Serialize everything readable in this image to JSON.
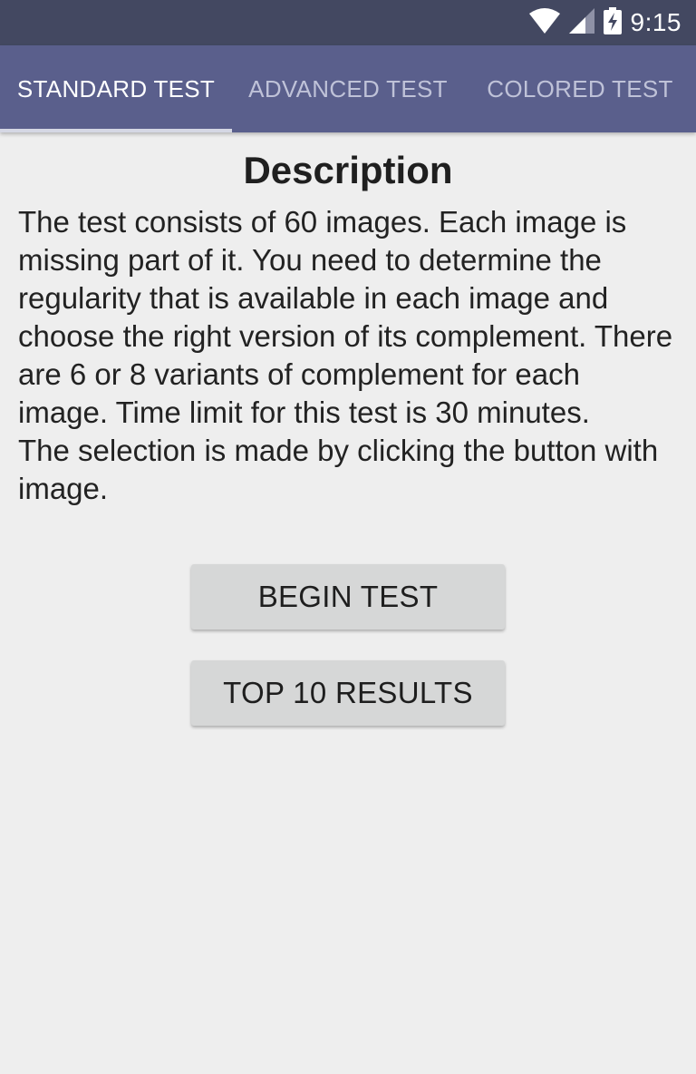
{
  "status_bar": {
    "time": "9:15",
    "icons": [
      "wifi-icon",
      "cell-signal-icon",
      "battery-charging-icon"
    ]
  },
  "tabs": [
    {
      "label": "STANDARD TEST",
      "selected": true
    },
    {
      "label": "ADVANCED TEST",
      "selected": false
    },
    {
      "label": "COLORED TEST",
      "selected": false
    }
  ],
  "main": {
    "title": "Description",
    "description": "The test consists of 60 images. Each image is missing part of it. You need to determine the regularity that is available in each image and choose the right version of its complement. There are 6 or 8 variants of complement for each image. Time limit for this test is 30 minutes.\nThe selection is made by clicking the button with image.",
    "begin_button_label": "BEGIN TEST",
    "top10_button_label": "TOP 10 RESULTS"
  },
  "colors": {
    "status_bar": "#434861",
    "tab_bar": "#5a5f8c",
    "background": "#eeeeee",
    "button": "#d6d7d7"
  }
}
